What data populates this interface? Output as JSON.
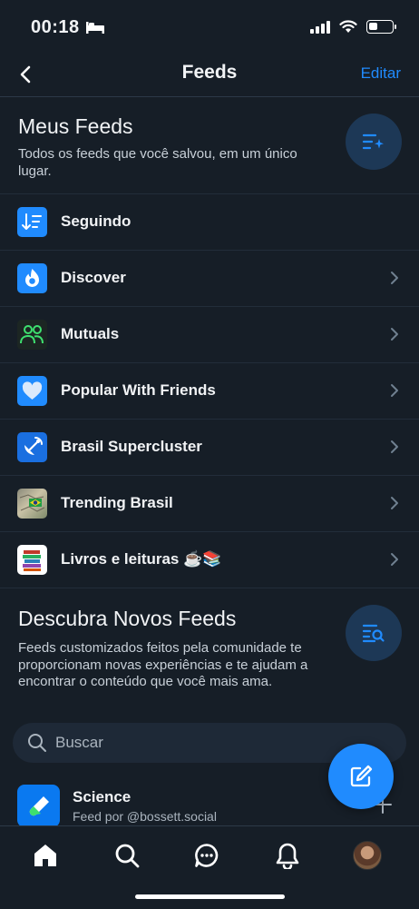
{
  "status": {
    "time": "00:18"
  },
  "nav": {
    "title": "Feeds",
    "edit_label": "Editar"
  },
  "my_feeds": {
    "title": "Meus Feeds",
    "description": "Todos os feeds que você salvou, em um único lugar.",
    "items": [
      {
        "label": "Seguindo",
        "icon": "following-sort-icon",
        "color": "#208bfe"
      },
      {
        "label": "Discover",
        "icon": "discover-flame-icon",
        "color": "#208bfe"
      },
      {
        "label": "Mutuals",
        "icon": "mutuals-people-icon",
        "color": "#1a2a22"
      },
      {
        "label": "Popular With Friends",
        "icon": "heart-icon",
        "color": "#208bfe"
      },
      {
        "label": "Brasil Supercluster",
        "icon": "satellite-icon",
        "color": "#208bfe"
      },
      {
        "label": "Trending Brasil",
        "icon": "brasil-map-icon",
        "color": "#b8b090"
      },
      {
        "label": "Livros e leituras ☕📚",
        "icon": "books-icon",
        "color": "#ffffff"
      }
    ]
  },
  "discover": {
    "title": "Descubra Novos Feeds",
    "description": "Feeds customizados feitos pela comunidade te proporcionam novas experiências e te ajudam a encontrar o conteúdo que você mais ama."
  },
  "search": {
    "placeholder": "Buscar"
  },
  "suggested_feed": {
    "name": "Science",
    "byline": "Feed por @bossett.social",
    "icon": "test-tube-icon"
  },
  "colors": {
    "accent": "#208bfe",
    "background": "#161e27"
  }
}
